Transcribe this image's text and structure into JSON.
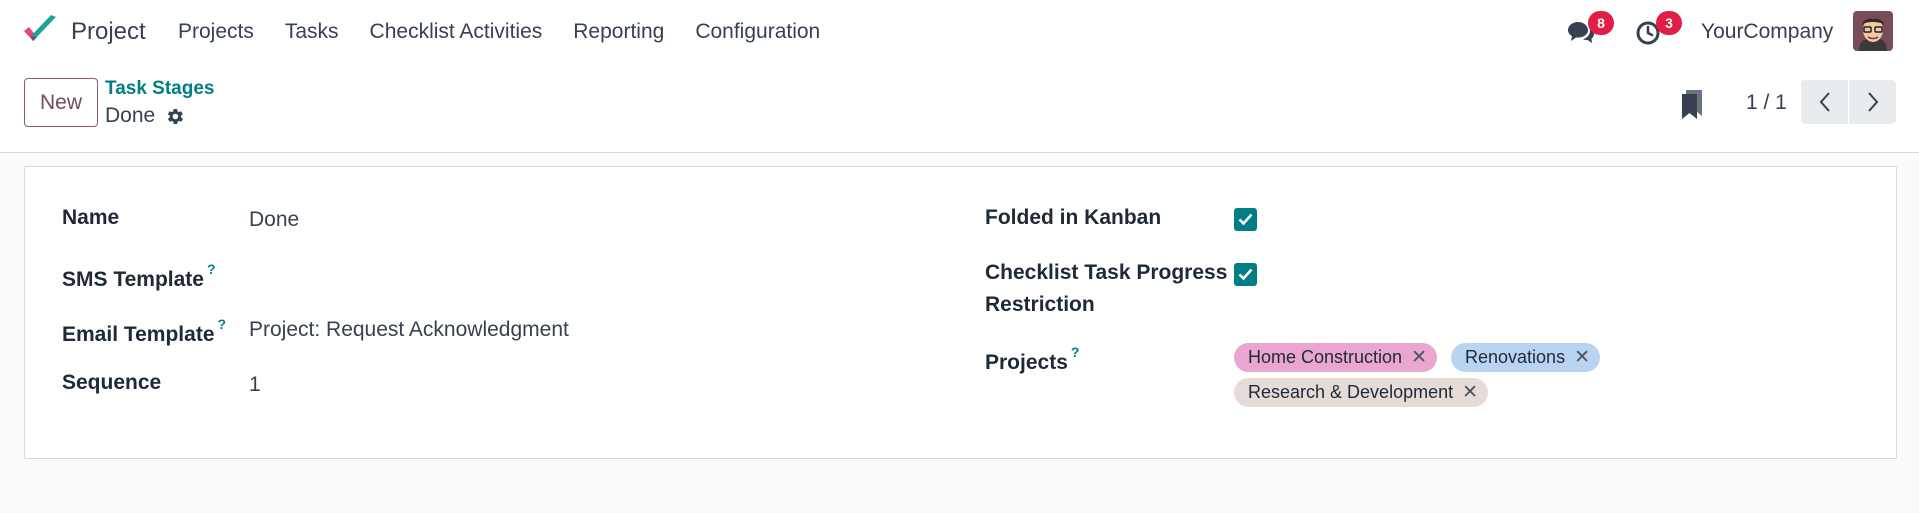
{
  "app": {
    "name": "Project",
    "menu": [
      "Projects",
      "Tasks",
      "Checklist Activities",
      "Reporting",
      "Configuration"
    ]
  },
  "systray": {
    "messages_count": "8",
    "activities_count": "3",
    "company": "YourCompany"
  },
  "control": {
    "new_label": "New",
    "breadcrumb_parent": "Task Stages",
    "breadcrumb_current": "Done",
    "pager": "1 / 1"
  },
  "form": {
    "name_label": "Name",
    "name_value": "Done",
    "sms_label": "SMS Template",
    "sms_value": "",
    "email_label": "Email Template",
    "email_value": "Project: Request Acknowledgment",
    "sequence_label": "Sequence",
    "sequence_value": "1",
    "folded_label": "Folded in Kanban",
    "folded_checked": true,
    "checklist_label_line1": "Checklist Task Progress",
    "checklist_label_line2": "Restriction",
    "checklist_checked": true,
    "projects_label": "Projects",
    "help_mark": "?",
    "projects": [
      {
        "name": "Home Construction",
        "color": "#e8a6d0"
      },
      {
        "name": "Renovations",
        "color": "#b9d4f3"
      },
      {
        "name": "Research & Development",
        "color": "#e5dcd8"
      }
    ]
  },
  "icons": {
    "logo": "project-logo-icon",
    "messages": "chat-bubbles-icon",
    "activities": "clock-icon",
    "gear": "gear-icon",
    "bookmark": "bookmark-icon",
    "prev": "chevron-left-icon",
    "next": "chevron-right-icon",
    "check": "check-icon",
    "remove": "close-icon"
  },
  "colors": {
    "brand": "#714b67",
    "accent": "#017e84",
    "badge": "#e11d48"
  }
}
